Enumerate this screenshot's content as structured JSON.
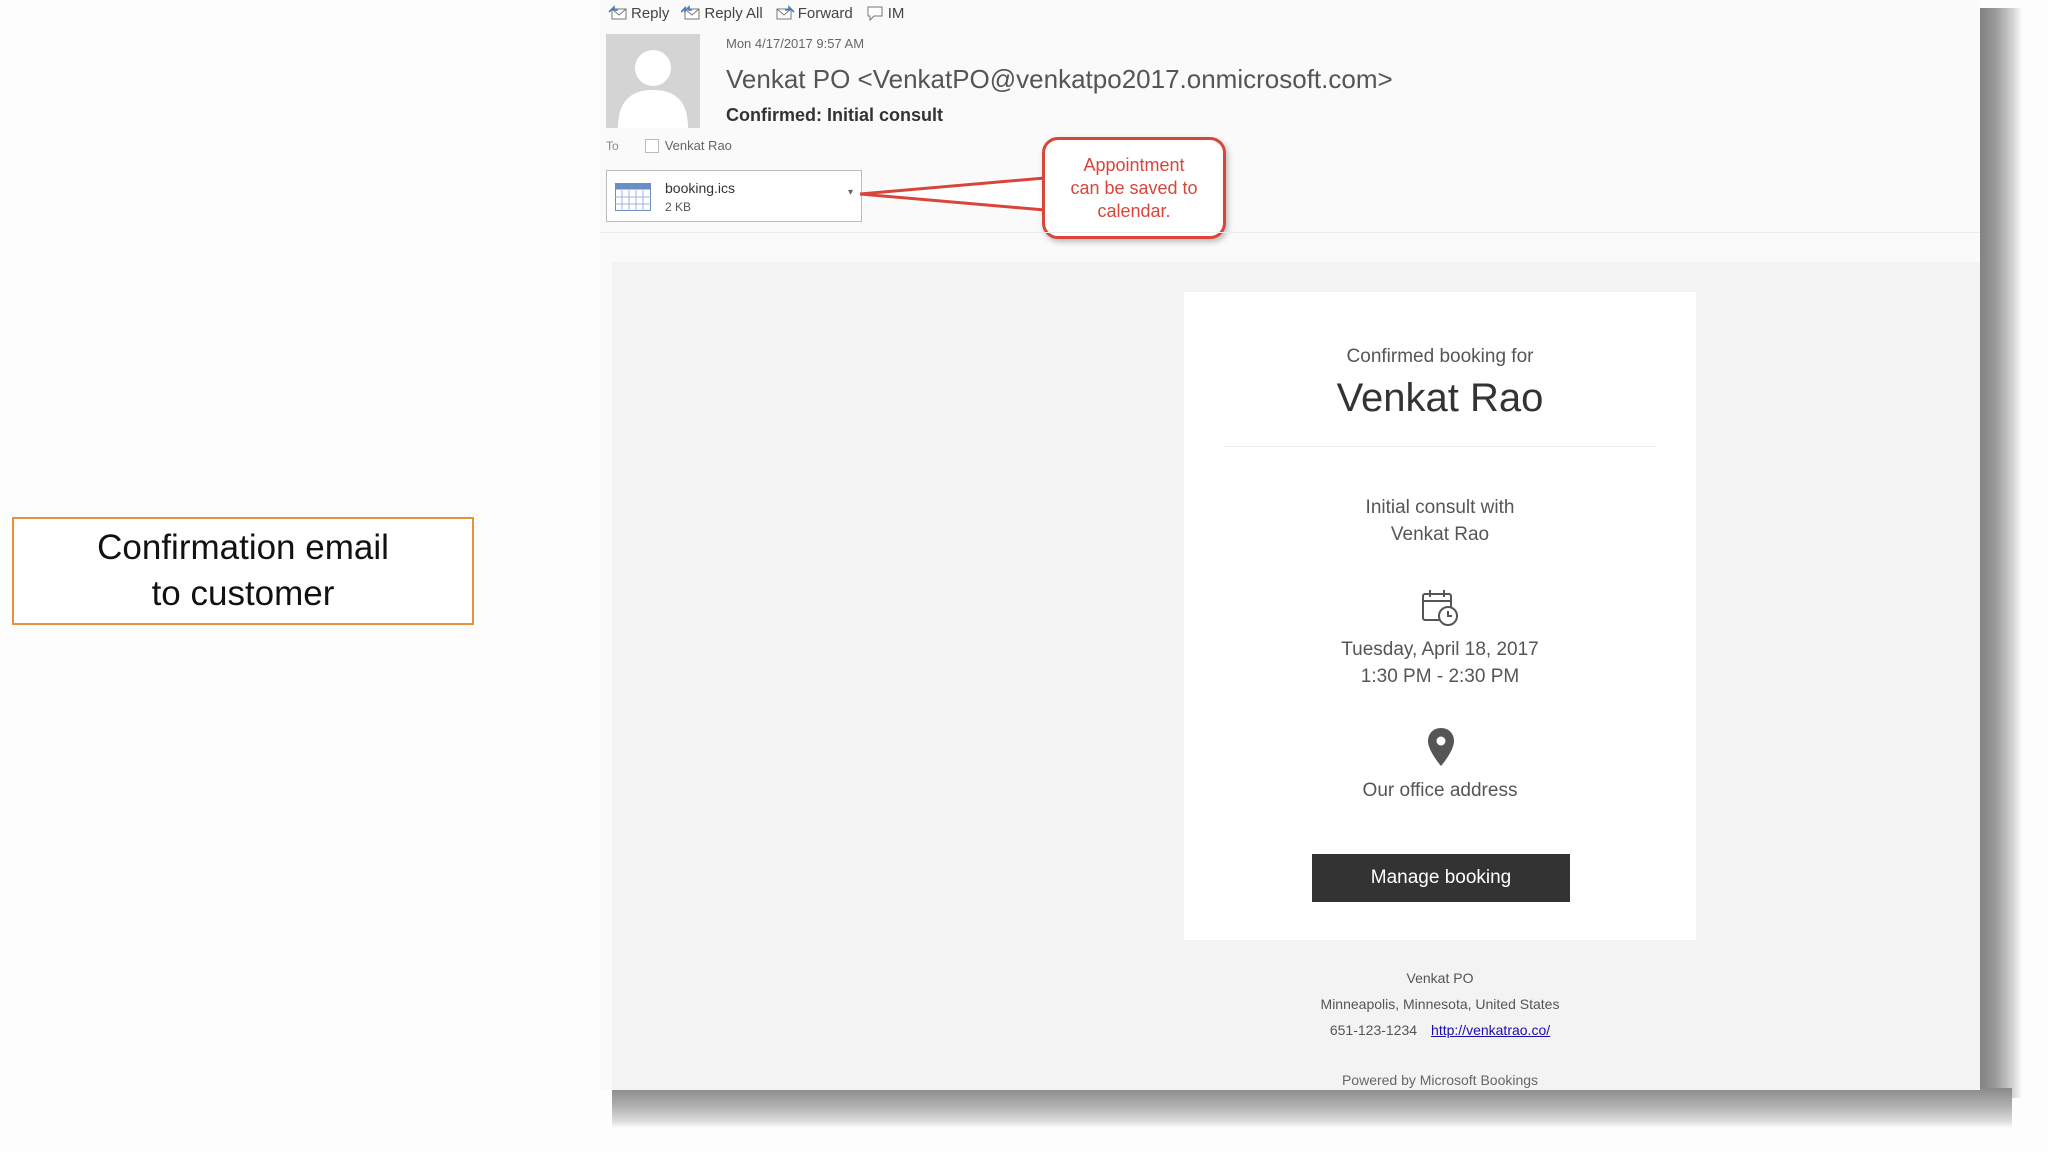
{
  "slide_label": {
    "line1": "Confirmation email",
    "line2": "to customer"
  },
  "toolbar": {
    "reply": "Reply",
    "reply_all": "Reply All",
    "forward": "Forward",
    "im": "IM"
  },
  "email": {
    "date": "Mon 4/17/2017 9:57 AM",
    "sender": "Venkat PO <VenkatPO@venkatpo2017.onmicrosoft.com>",
    "subject": "Confirmed: Initial consult",
    "to_label": "To",
    "to_name": "Venkat Rao"
  },
  "attachment": {
    "name": "booking.ics",
    "size": "2 KB"
  },
  "callout": {
    "line1": "Appointment",
    "line2": "can be saved to",
    "line3": "calendar."
  },
  "card": {
    "confirmed_for": "Confirmed booking for",
    "customer": "Venkat Rao",
    "service_line1": "Initial consult with",
    "service_line2": "Venkat Rao",
    "date": "Tuesday, April 18, 2017",
    "time": "1:30 PM - 2:30 PM",
    "address": "Our office address",
    "manage_button": "Manage booking"
  },
  "footer": {
    "business": "Venkat PO",
    "location": "Minneapolis, Minnesota, United States",
    "phone": "651-123-1234",
    "url": "http://venkatrao.co/",
    "powered": "Powered by Microsoft Bookings"
  },
  "colors": {
    "accent_orange": "#e8903a",
    "callout_red": "#d9453b",
    "button_dark": "#333333"
  }
}
